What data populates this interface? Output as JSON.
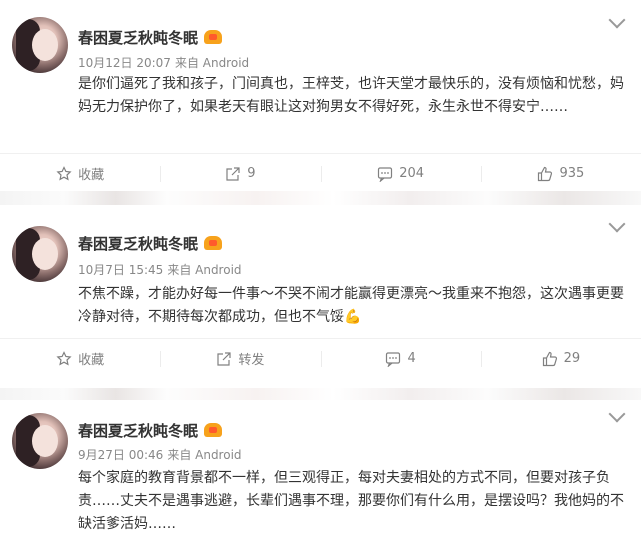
{
  "posts": [
    {
      "username": "春困夏乏秋盹冬眠",
      "time": "10月12日 20:07",
      "source": "来自 Android",
      "content": "是你们逼死了我和孩子，门间真也，王梓芠，也许天堂才最快乐的，没有烦恼和忧愁，妈妈无力保护你了，如果老天有眼让这对狗男女不得好死，永生永世不得安宁……",
      "actions": {
        "favorite": "收藏",
        "repost": "9",
        "comment": "204",
        "like": "935"
      }
    },
    {
      "username": "春困夏乏秋盹冬眠",
      "time": "10月7日 15:45",
      "source": "来自 Android",
      "content": "不焦不躁，才能办好每一件事～不哭不闹才能赢得更漂亮～我重来不抱怨，这次遇事更要冷静对待，不期待每次都成功，但也不气馁💪",
      "actions": {
        "favorite": "收藏",
        "repost": "转发",
        "comment": "4",
        "like": "29"
      }
    },
    {
      "username": "春困夏乏秋盹冬眠",
      "time": "9月27日 00:46",
      "source": "来自 Android",
      "content": "每个家庭的教育背景都不一样，但三观得正，每对夫妻相处的方式不同，但要对孩子负责……丈夫不是遇事逃避，长辈们遇事不理，那要你们有什么用，是摆设吗？我他妈的不缺活爹活妈……"
    }
  ],
  "icons": {
    "vip": "vip-crown-icon",
    "favorite": "star-icon",
    "repost": "share-icon",
    "comment": "comment-icon",
    "like": "thumbs-up-icon",
    "menu": "chevron-down-icon"
  },
  "colors": {
    "text": "#333333",
    "meta": "#888888",
    "vip": "#f7a21c"
  }
}
